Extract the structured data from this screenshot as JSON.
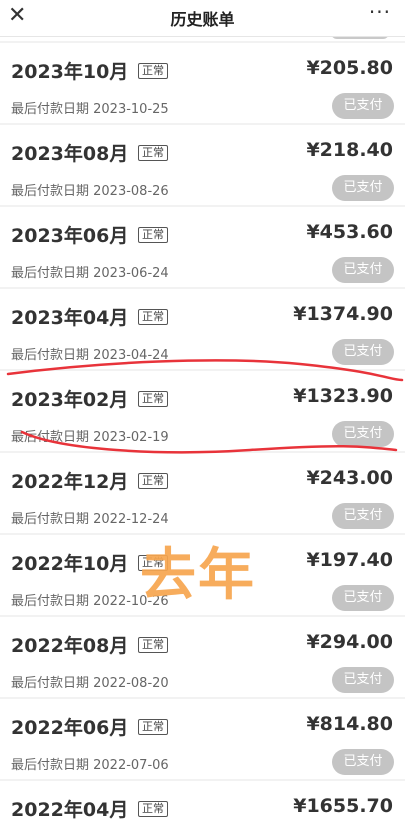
{
  "header": {
    "title": "历史账单",
    "close_icon": "close-icon",
    "more_icon": "more-icon"
  },
  "bills": [
    {
      "month": "2023年10月",
      "tag": "正常",
      "amount": "¥205.80",
      "due": "最后付款日期 2023-10-25",
      "status": "已支付"
    },
    {
      "month": "2023年08月",
      "tag": "正常",
      "amount": "¥218.40",
      "due": "最后付款日期 2023-08-26",
      "status": "已支付"
    },
    {
      "month": "2023年06月",
      "tag": "正常",
      "amount": "¥453.60",
      "due": "最后付款日期 2023-06-24",
      "status": "已支付"
    },
    {
      "month": "2023年04月",
      "tag": "正常",
      "amount": "¥1374.90",
      "due": "最后付款日期 2023-04-24",
      "status": "已支付"
    },
    {
      "month": "2023年02月",
      "tag": "正常",
      "amount": "¥1323.90",
      "due": "最后付款日期 2023-02-19",
      "status": "已支付"
    },
    {
      "month": "2022年12月",
      "tag": "正常",
      "amount": "¥243.00",
      "due": "最后付款日期 2022-12-24",
      "status": "已支付"
    },
    {
      "month": "2022年10月",
      "tag": "正常",
      "amount": "¥197.40",
      "due": "最后付款日期 2022-10-26",
      "status": "已支付"
    },
    {
      "month": "2022年08月",
      "tag": "正常",
      "amount": "¥294.00",
      "due": "最后付款日期 2022-08-20",
      "status": "已支付"
    },
    {
      "month": "2022年06月",
      "tag": "正常",
      "amount": "¥814.80",
      "due": "最后付款日期 2022-07-06",
      "status": "已支付"
    },
    {
      "month": "2022年04月",
      "tag": "正常",
      "amount": "¥1655.70",
      "due": "",
      "status": ""
    }
  ],
  "annotation": {
    "stamp_text": "去年",
    "stamp_color": "#f7a64f",
    "line_color": "#e8333a"
  }
}
